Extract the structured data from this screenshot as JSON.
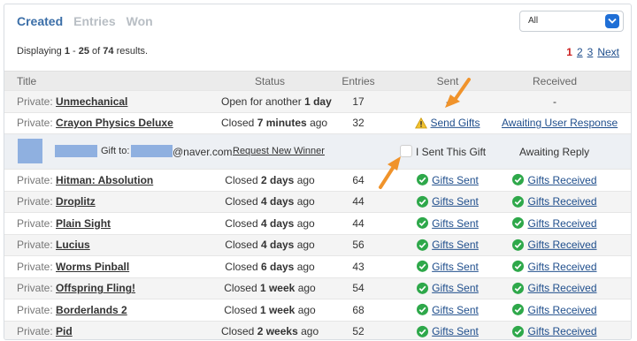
{
  "tabs": [
    "Created",
    "Entries",
    "Won"
  ],
  "filter": {
    "value": "All"
  },
  "summary": {
    "prefix": "Displaying",
    "from": "1",
    "dash": "-",
    "to": "25",
    "of": "of",
    "total": "74",
    "suffix": "results."
  },
  "pagination": {
    "current": "1",
    "pages": [
      "2",
      "3"
    ],
    "next": "Next"
  },
  "headers": {
    "title": "Title",
    "status": "Status",
    "entries": "Entries",
    "sent": "Sent",
    "received": "Received"
  },
  "private_prefix": "Private:",
  "rows": [
    {
      "name": "Unmechanical",
      "status_pre": "Open for another",
      "status_bold": "1 day",
      "status_post": "",
      "entries": "17",
      "sent": "-",
      "received": "-"
    },
    {
      "name": "Crayon Physics Deluxe",
      "status_pre": "Closed",
      "status_bold": "7 minutes",
      "status_post": "ago",
      "entries": "32",
      "sent": "Send Gifts",
      "received": "Awaiting User Response"
    },
    {
      "name": "Hitman: Absolution",
      "status_pre": "Closed",
      "status_bold": "2 days",
      "status_post": "ago",
      "entries": "64",
      "sent": "Gifts Sent",
      "received": "Gifts Received"
    },
    {
      "name": "Droplitz",
      "status_pre": "Closed",
      "status_bold": "4 days",
      "status_post": "ago",
      "entries": "44",
      "sent": "Gifts Sent",
      "received": "Gifts Received"
    },
    {
      "name": "Plain Sight",
      "status_pre": "Closed",
      "status_bold": "4 days",
      "status_post": "ago",
      "entries": "44",
      "sent": "Gifts Sent",
      "received": "Gifts Received"
    },
    {
      "name": "Lucius",
      "status_pre": "Closed",
      "status_bold": "4 days",
      "status_post": "ago",
      "entries": "56",
      "sent": "Gifts Sent",
      "received": "Gifts Received"
    },
    {
      "name": "Worms Pinball",
      "status_pre": "Closed",
      "status_bold": "6 days",
      "status_post": "ago",
      "entries": "43",
      "sent": "Gifts Sent",
      "received": "Gifts Received"
    },
    {
      "name": "Offspring Fling!",
      "status_pre": "Closed",
      "status_bold": "1 week",
      "status_post": "ago",
      "entries": "54",
      "sent": "Gifts Sent",
      "received": "Gifts Received"
    },
    {
      "name": "Borderlands 2",
      "status_pre": "Closed",
      "status_bold": "1 week",
      "status_post": "ago",
      "entries": "68",
      "sent": "Gifts Sent",
      "received": "Gifts Received"
    },
    {
      "name": "Pid",
      "status_pre": "Closed",
      "status_bold": "2 weeks",
      "status_post": "ago",
      "entries": "52",
      "sent": "Gifts Sent",
      "received": "Gifts Received"
    }
  ],
  "gift_row": {
    "gift_to": "Gift to:",
    "email_domain": "@naver.com",
    "request_new": "Request New Winner",
    "checkbox_label": "I Sent This Gift",
    "status": "Awaiting Reply"
  },
  "colors": {
    "accent": "#3c6fa8",
    "link": "#1f4e8c",
    "success": "#2ea84a",
    "warning": "#f2c230",
    "annotation_arrow": "#f0932b",
    "redaction": "#8fb0e0"
  }
}
